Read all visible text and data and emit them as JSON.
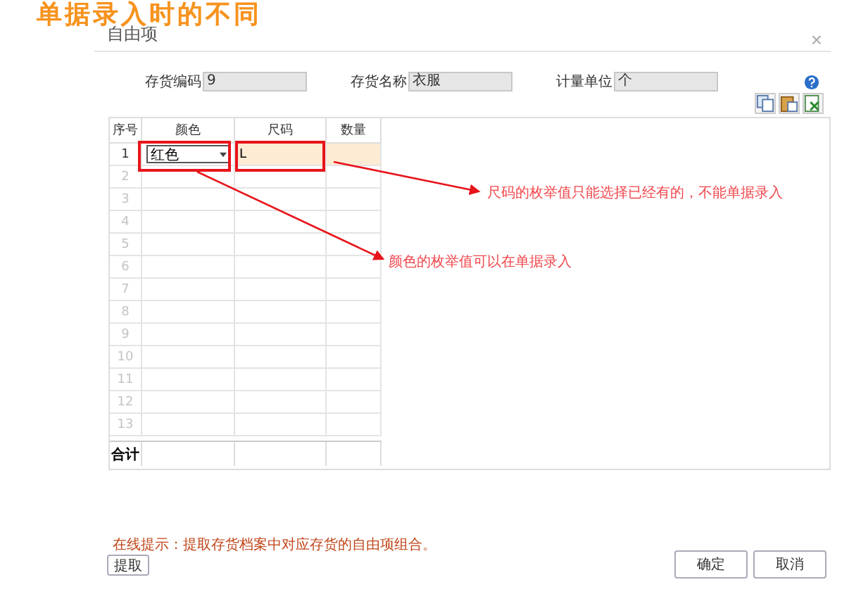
{
  "heading": "单据录入时的不同",
  "dialog": {
    "title": "自由项",
    "close": "×"
  },
  "fields": [
    {
      "label": "存货编码",
      "value": "9"
    },
    {
      "label": "存货名称",
      "value": "衣服"
    },
    {
      "label": "计量单位",
      "value": "个"
    }
  ],
  "table": {
    "columns": [
      "序号",
      "颜色",
      "尺码",
      "数量"
    ],
    "rows": [
      {
        "no": "1",
        "color_name": "红色",
        "size": "L",
        "active": true
      },
      {
        "no": "2",
        "active": false
      },
      {
        "no": "3",
        "active": false
      },
      {
        "no": "4",
        "active": false
      },
      {
        "no": "5",
        "active": false
      },
      {
        "no": "6",
        "active": false
      },
      {
        "no": "7",
        "active": false
      },
      {
        "no": "8",
        "active": false
      },
      {
        "no": "9",
        "active": false
      },
      {
        "no": "10",
        "active": false
      },
      {
        "no": "11",
        "active": false
      },
      {
        "no": "12",
        "active": false
      },
      {
        "no": "13",
        "active": false
      }
    ],
    "total_label": "合计"
  },
  "annotations": [
    {
      "text": "尺码的枚举值只能选择已经有的，不能单据录入"
    },
    {
      "text": "颜色的枚举值可以在单据录入"
    }
  ],
  "hint": "在线提示：提取存货档案中对应存货的自由项组合。",
  "buttons": {
    "extract": "提取",
    "ok": "确定",
    "cancel": "取消"
  }
}
